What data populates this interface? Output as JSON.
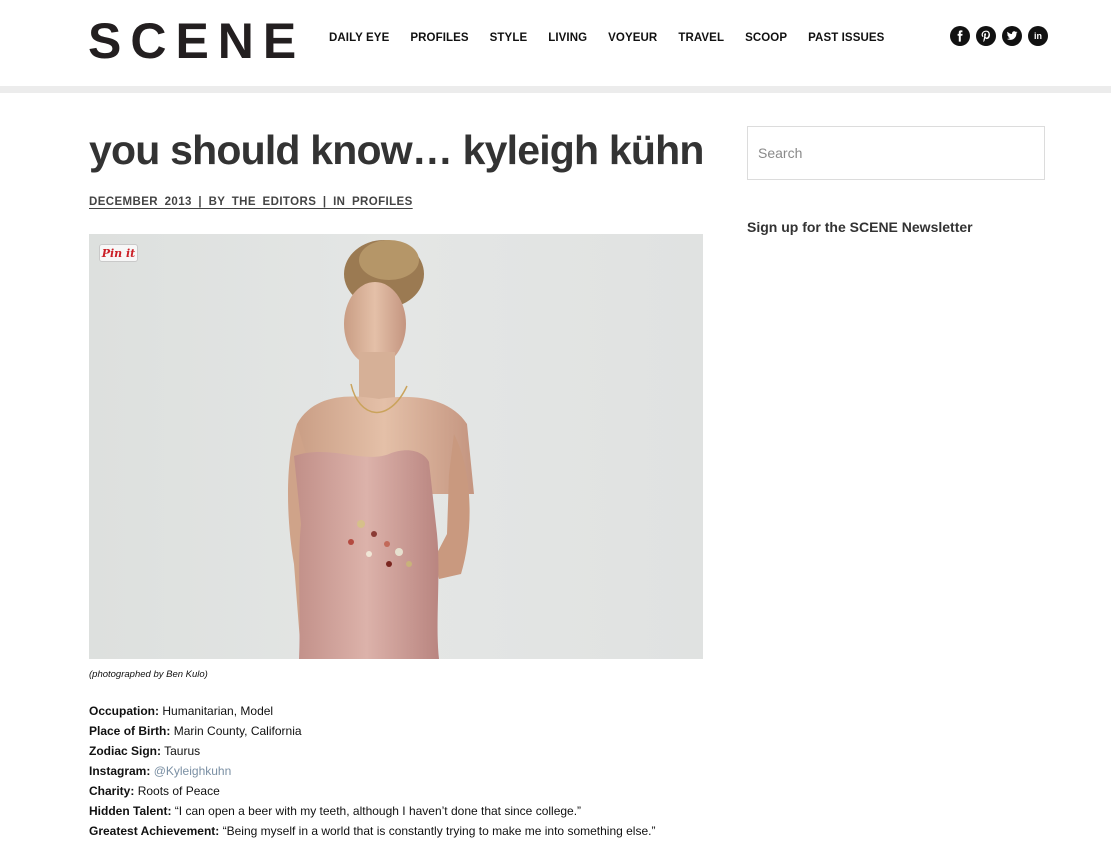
{
  "header": {
    "logo": "SCENE",
    "nav": [
      "DAILY EYE",
      "PROFILES",
      "STYLE",
      "LIVING",
      "VOYEUR",
      "TRAVEL",
      "SCOOP",
      "PAST ISSUES"
    ],
    "social": [
      "facebook-icon",
      "pinterest-icon",
      "twitter-icon",
      "linkedin-icon"
    ]
  },
  "article": {
    "title": "you should know… kyleigh kühn",
    "meta": "DECEMBER 2013 | BY THE EDITORS | IN PROFILES",
    "pin_label": "Pin it",
    "caption": "(photographed by Ben Kulo)",
    "facts": [
      {
        "label": "Occupation:",
        "value": "Humanitarian, Model"
      },
      {
        "label": "Place of Birth:",
        "value": "Marin County, California"
      },
      {
        "label": "Zodiac Sign:",
        "value": "Taurus"
      },
      {
        "label": "Instagram:",
        "value": "@Kyleighkuhn",
        "link": true
      },
      {
        "label": "Charity:",
        "value": "Roots of Peace"
      },
      {
        "label": "Hidden Talent:",
        "value": "“I can open a beer with my teeth, although I haven’t done that since college.”"
      },
      {
        "label": "Greatest Achievement:",
        "value": "“Being myself in a world that is constantly trying to make me into something else.”"
      }
    ]
  },
  "sidebar": {
    "search_placeholder": "Search",
    "newsletter_heading": "Sign up for the SCENE Newsletter"
  },
  "colors": {
    "accent_link": "#7a8fa3",
    "pin_red": "#cb2027",
    "dress": "#d3a49d"
  }
}
